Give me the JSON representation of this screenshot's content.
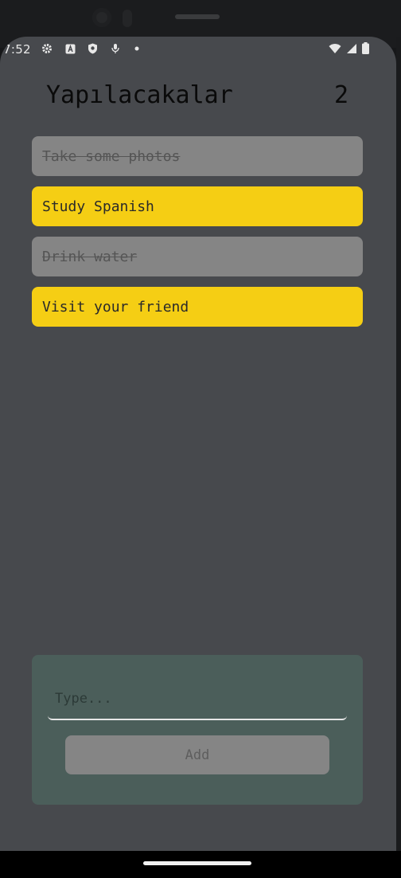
{
  "status_bar": {
    "time": "7:52",
    "left_icons": [
      "settings-icon",
      "a-badge-icon",
      "shield-icon",
      "mic-icon",
      "dot-icon"
    ],
    "right_icons": [
      "wifi-icon",
      "signal-icon",
      "battery-icon"
    ]
  },
  "header": {
    "title": "Yapılacakalar",
    "count": "2"
  },
  "todos": [
    {
      "label": "Take some photos",
      "done": true
    },
    {
      "label": "Study Spanish",
      "done": false
    },
    {
      "label": "Drink water",
      "done": true
    },
    {
      "label": "Visit your friend",
      "done": false
    }
  ],
  "composer": {
    "placeholder": "Type...",
    "value": "",
    "add_label": "Add"
  },
  "colors": {
    "screen_bg": "#47494d",
    "active_item": "#f5ce14",
    "done_item": "#858585",
    "composer_bg": "#4b5e5a"
  }
}
